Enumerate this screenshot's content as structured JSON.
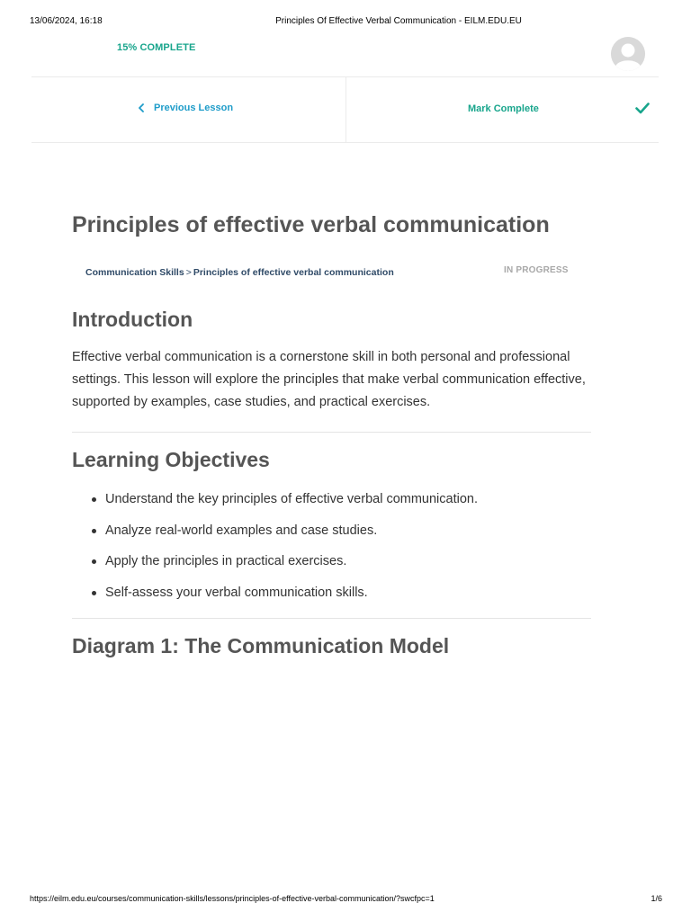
{
  "print_header": {
    "datetime": "13/06/2024, 16:18",
    "title": "Principles Of Effective Verbal Communication - EILM.EDU.EU"
  },
  "print_footer": {
    "url": "https://eilm.edu.eu/courses/communication-skills/lessons/principles-of-effective-verbal-communication/?swcfpc=1",
    "page": "1/6"
  },
  "progress": {
    "label": "15% COMPLETE",
    "percent": 15
  },
  "nav": {
    "previous_label": "Previous Lesson",
    "mark_complete_label": "Mark Complete"
  },
  "lesson": {
    "title": "Principles of effective verbal communication",
    "breadcrumb": {
      "course": "Communication Skills",
      "separator": ">",
      "lesson": "Principles of effective verbal communication"
    },
    "status": "IN PROGRESS"
  },
  "sections": {
    "introduction": {
      "heading": "Introduction",
      "body": "Effective verbal communication is a cornerstone skill in both personal and professional settings. This lesson will explore the principles that make verbal communication effective, supported by examples, case studies, and practical exercises."
    },
    "objectives": {
      "heading": "Learning Objectives",
      "items": [
        "Understand the key principles of effective verbal communication.",
        "Analyze real-world examples and case studies.",
        "Apply the principles in practical exercises.",
        "Self-assess your verbal communication skills."
      ]
    },
    "diagram": {
      "heading": "Diagram 1: The Communication Model"
    }
  },
  "colors": {
    "accent_green": "#18a58c",
    "link_blue": "#1e9cc9",
    "breadcrumb_navy": "#2f4a67",
    "heading_gray": "#555555"
  },
  "icons": {
    "avatar": "default-user-avatar",
    "previous": "chevron-left-icon",
    "complete": "checkmark-icon"
  }
}
